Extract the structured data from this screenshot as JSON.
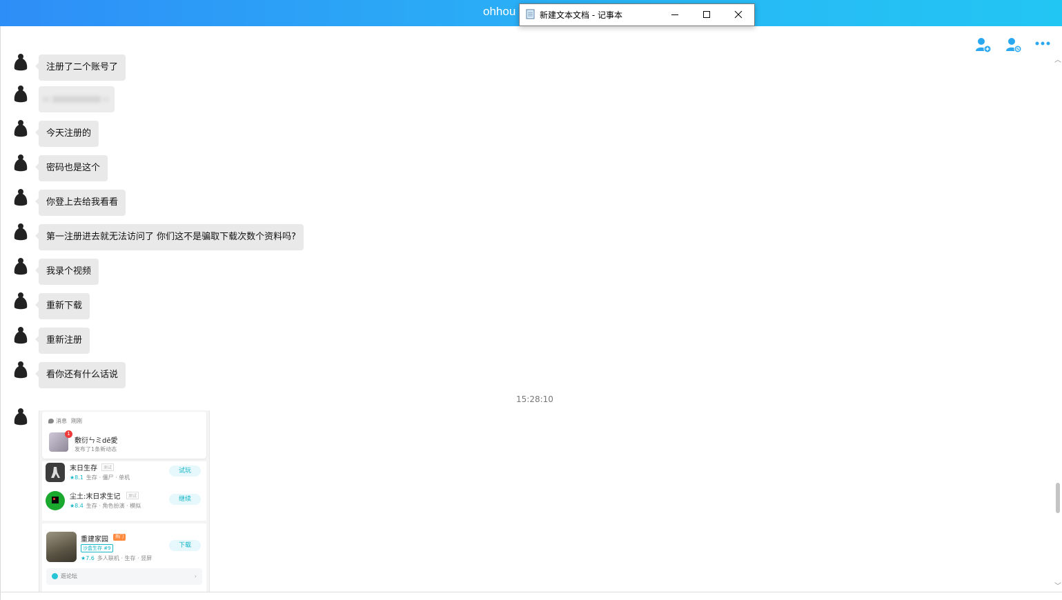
{
  "app": {
    "title": "ohhou",
    "accent_color": "#29b6f6"
  },
  "toolbar": {
    "icons": [
      "add-user-icon",
      "block-user-icon",
      "more-icon"
    ]
  },
  "messages": [
    {
      "text": "注册了二个账号了"
    },
    {
      "text": ""
    },
    {
      "text": "今天注册的"
    },
    {
      "text": "密码也是这个"
    },
    {
      "text": "你登上去给我看看"
    },
    {
      "text": "第一注册进去就无法访问了 你们这不是骗取下载次数个资料吗?"
    },
    {
      "text": "我录个视频"
    },
    {
      "text": "重新下载"
    },
    {
      "text": "重新注册"
    },
    {
      "text": "看你还有什么话说"
    }
  ],
  "timestamp": "15:28:10",
  "image_message": {
    "notification": {
      "label": "消息",
      "time": "刚刚",
      "badge": "1",
      "name": "敷衍ㄣミdē愛",
      "sub": "发布了1条新动态"
    },
    "games": [
      {
        "name": "末日生存",
        "tag": "测试",
        "score": "★8.1",
        "meta": "生存 · 僵尸 · 单机",
        "button": "试玩"
      },
      {
        "name": "尘土:末日求生记",
        "tag": "测试",
        "score": "★8.4",
        "meta": "生存 · 角色扮演 · 模拟",
        "button": "继续"
      }
    ],
    "featured": {
      "name": "重建家园",
      "hot": "热门",
      "rank": "沙盒生存 #9",
      "score": "★7.6",
      "meta": "多人联机 · 生存 · 竖屏",
      "button": "下载",
      "forum": "逛论坛",
      "arrow": "›"
    }
  },
  "notepad": {
    "title": "新建文本文档 - 记事本"
  }
}
